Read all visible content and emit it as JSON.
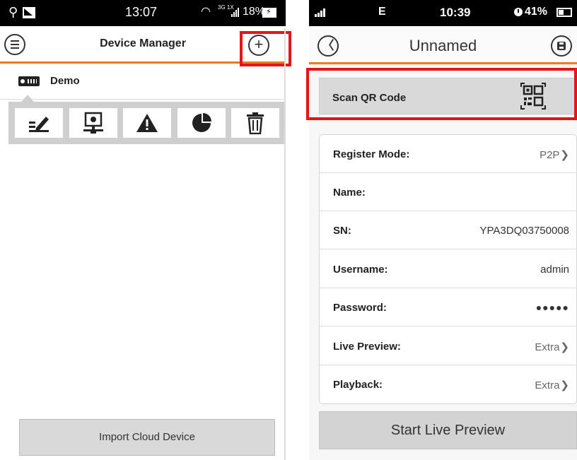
{
  "left_status": {
    "time": "13:07",
    "network": "3G 1X",
    "battery_pct": "18%",
    "icons": [
      "usb-icon",
      "image-icon",
      "wifi-icon",
      "signal-icon",
      "battery-charging-icon"
    ]
  },
  "left_header": {
    "title": "Device Manager",
    "menu_icon": "menu-icon",
    "add_icon": "plus-icon",
    "add_label": "+"
  },
  "device": {
    "name": "Demo",
    "icon": "dvr-icon"
  },
  "device_toolbar": {
    "items": [
      "edit-icon",
      "remote-config-icon",
      "alarm-icon",
      "info-chart-icon",
      "delete-icon"
    ]
  },
  "import_button": {
    "label": "Import Cloud Device"
  },
  "right_status": {
    "network": "E",
    "time": "10:39",
    "battery_pct": "41%"
  },
  "right_header": {
    "title": "Unnamed",
    "back_label": "〈",
    "save_icon": "save-icon"
  },
  "scan": {
    "label": "Scan QR Code",
    "icon": "qr-code-icon"
  },
  "form": {
    "rows": [
      {
        "key": "Register Mode:",
        "value": "P2P",
        "chevron": "❯"
      },
      {
        "key": "Name:",
        "value": ""
      },
      {
        "key": "SN:",
        "value": "YPA3DQ03750008"
      },
      {
        "key": "Username:",
        "value": "admin"
      },
      {
        "key": "Password:",
        "value": "●●●●●"
      },
      {
        "key": "Live Preview:",
        "value": "Extra",
        "chevron": "❯"
      },
      {
        "key": "Playback:",
        "value": "Extra",
        "chevron": "❯"
      }
    ]
  },
  "start_button": {
    "label": "Start Live Preview"
  },
  "colors": {
    "accent_orange": "#f07a20",
    "highlight_red": "#e5141b",
    "button_gray": "#d9d9d9"
  }
}
